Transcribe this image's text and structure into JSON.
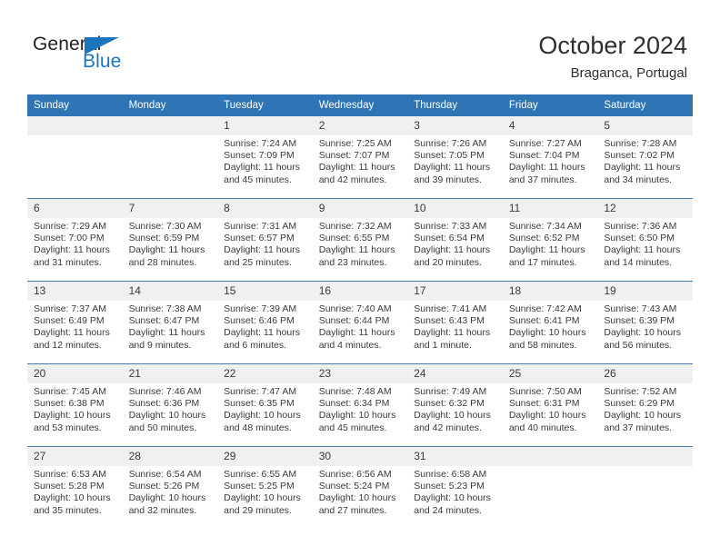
{
  "brand": {
    "name_top": "General",
    "name_bottom": "Blue",
    "triangle_color": "#1b75bc"
  },
  "header": {
    "title": "October 2024",
    "subtitle": "Braganca, Portugal",
    "accent_color": "#2f75b5",
    "daynum_bg": "#f0f0f0"
  },
  "weekdays": [
    "Sunday",
    "Monday",
    "Tuesday",
    "Wednesday",
    "Thursday",
    "Friday",
    "Saturday"
  ],
  "labels": {
    "sunrise": "Sunrise:",
    "sunset": "Sunset:",
    "daylight": "Daylight:"
  },
  "weeks": [
    [
      {
        "day": "",
        "sunrise": "",
        "sunset": "",
        "daylight": "",
        "empty": true
      },
      {
        "day": "",
        "sunrise": "",
        "sunset": "",
        "daylight": "",
        "empty": true
      },
      {
        "day": "1",
        "sunrise": "Sunrise: 7:24 AM",
        "sunset": "Sunset: 7:09 PM",
        "daylight": "Daylight: 11 hours and 45 minutes."
      },
      {
        "day": "2",
        "sunrise": "Sunrise: 7:25 AM",
        "sunset": "Sunset: 7:07 PM",
        "daylight": "Daylight: 11 hours and 42 minutes."
      },
      {
        "day": "3",
        "sunrise": "Sunrise: 7:26 AM",
        "sunset": "Sunset: 7:05 PM",
        "daylight": "Daylight: 11 hours and 39 minutes."
      },
      {
        "day": "4",
        "sunrise": "Sunrise: 7:27 AM",
        "sunset": "Sunset: 7:04 PM",
        "daylight": "Daylight: 11 hours and 37 minutes."
      },
      {
        "day": "5",
        "sunrise": "Sunrise: 7:28 AM",
        "sunset": "Sunset: 7:02 PM",
        "daylight": "Daylight: 11 hours and 34 minutes."
      }
    ],
    [
      {
        "day": "6",
        "sunrise": "Sunrise: 7:29 AM",
        "sunset": "Sunset: 7:00 PM",
        "daylight": "Daylight: 11 hours and 31 minutes."
      },
      {
        "day": "7",
        "sunrise": "Sunrise: 7:30 AM",
        "sunset": "Sunset: 6:59 PM",
        "daylight": "Daylight: 11 hours and 28 minutes."
      },
      {
        "day": "8",
        "sunrise": "Sunrise: 7:31 AM",
        "sunset": "Sunset: 6:57 PM",
        "daylight": "Daylight: 11 hours and 25 minutes."
      },
      {
        "day": "9",
        "sunrise": "Sunrise: 7:32 AM",
        "sunset": "Sunset: 6:55 PM",
        "daylight": "Daylight: 11 hours and 23 minutes."
      },
      {
        "day": "10",
        "sunrise": "Sunrise: 7:33 AM",
        "sunset": "Sunset: 6:54 PM",
        "daylight": "Daylight: 11 hours and 20 minutes."
      },
      {
        "day": "11",
        "sunrise": "Sunrise: 7:34 AM",
        "sunset": "Sunset: 6:52 PM",
        "daylight": "Daylight: 11 hours and 17 minutes."
      },
      {
        "day": "12",
        "sunrise": "Sunrise: 7:36 AM",
        "sunset": "Sunset: 6:50 PM",
        "daylight": "Daylight: 11 hours and 14 minutes."
      }
    ],
    [
      {
        "day": "13",
        "sunrise": "Sunrise: 7:37 AM",
        "sunset": "Sunset: 6:49 PM",
        "daylight": "Daylight: 11 hours and 12 minutes."
      },
      {
        "day": "14",
        "sunrise": "Sunrise: 7:38 AM",
        "sunset": "Sunset: 6:47 PM",
        "daylight": "Daylight: 11 hours and 9 minutes."
      },
      {
        "day": "15",
        "sunrise": "Sunrise: 7:39 AM",
        "sunset": "Sunset: 6:46 PM",
        "daylight": "Daylight: 11 hours and 6 minutes."
      },
      {
        "day": "16",
        "sunrise": "Sunrise: 7:40 AM",
        "sunset": "Sunset: 6:44 PM",
        "daylight": "Daylight: 11 hours and 4 minutes."
      },
      {
        "day": "17",
        "sunrise": "Sunrise: 7:41 AM",
        "sunset": "Sunset: 6:43 PM",
        "daylight": "Daylight: 11 hours and 1 minute."
      },
      {
        "day": "18",
        "sunrise": "Sunrise: 7:42 AM",
        "sunset": "Sunset: 6:41 PM",
        "daylight": "Daylight: 10 hours and 58 minutes."
      },
      {
        "day": "19",
        "sunrise": "Sunrise: 7:43 AM",
        "sunset": "Sunset: 6:39 PM",
        "daylight": "Daylight: 10 hours and 56 minutes."
      }
    ],
    [
      {
        "day": "20",
        "sunrise": "Sunrise: 7:45 AM",
        "sunset": "Sunset: 6:38 PM",
        "daylight": "Daylight: 10 hours and 53 minutes."
      },
      {
        "day": "21",
        "sunrise": "Sunrise: 7:46 AM",
        "sunset": "Sunset: 6:36 PM",
        "daylight": "Daylight: 10 hours and 50 minutes."
      },
      {
        "day": "22",
        "sunrise": "Sunrise: 7:47 AM",
        "sunset": "Sunset: 6:35 PM",
        "daylight": "Daylight: 10 hours and 48 minutes."
      },
      {
        "day": "23",
        "sunrise": "Sunrise: 7:48 AM",
        "sunset": "Sunset: 6:34 PM",
        "daylight": "Daylight: 10 hours and 45 minutes."
      },
      {
        "day": "24",
        "sunrise": "Sunrise: 7:49 AM",
        "sunset": "Sunset: 6:32 PM",
        "daylight": "Daylight: 10 hours and 42 minutes."
      },
      {
        "day": "25",
        "sunrise": "Sunrise: 7:50 AM",
        "sunset": "Sunset: 6:31 PM",
        "daylight": "Daylight: 10 hours and 40 minutes."
      },
      {
        "day": "26",
        "sunrise": "Sunrise: 7:52 AM",
        "sunset": "Sunset: 6:29 PM",
        "daylight": "Daylight: 10 hours and 37 minutes."
      }
    ],
    [
      {
        "day": "27",
        "sunrise": "Sunrise: 6:53 AM",
        "sunset": "Sunset: 5:28 PM",
        "daylight": "Daylight: 10 hours and 35 minutes."
      },
      {
        "day": "28",
        "sunrise": "Sunrise: 6:54 AM",
        "sunset": "Sunset: 5:26 PM",
        "daylight": "Daylight: 10 hours and 32 minutes."
      },
      {
        "day": "29",
        "sunrise": "Sunrise: 6:55 AM",
        "sunset": "Sunset: 5:25 PM",
        "daylight": "Daylight: 10 hours and 29 minutes."
      },
      {
        "day": "30",
        "sunrise": "Sunrise: 6:56 AM",
        "sunset": "Sunset: 5:24 PM",
        "daylight": "Daylight: 10 hours and 27 minutes."
      },
      {
        "day": "31",
        "sunrise": "Sunrise: 6:58 AM",
        "sunset": "Sunset: 5:23 PM",
        "daylight": "Daylight: 10 hours and 24 minutes."
      },
      {
        "day": "",
        "sunrise": "",
        "sunset": "",
        "daylight": "",
        "empty": true
      },
      {
        "day": "",
        "sunrise": "",
        "sunset": "",
        "daylight": "",
        "empty": true
      }
    ]
  ]
}
